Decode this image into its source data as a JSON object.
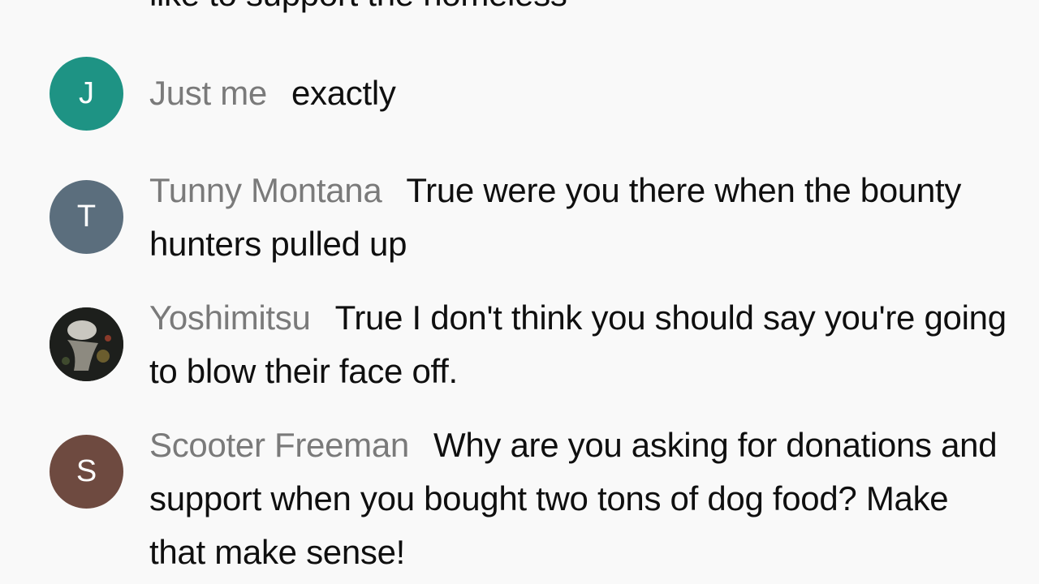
{
  "messages": [
    {
      "author": "",
      "text": "like to support the homeless",
      "avatar_letter": "",
      "avatar_color": "#9aa1a6"
    },
    {
      "author": "Just me",
      "text": "exactly",
      "avatar_letter": "J",
      "avatar_color": "#1e9384"
    },
    {
      "author": "Tunny Montana",
      "text": "True were you there when the bounty hunters pulled up",
      "avatar_letter": "T",
      "avatar_color": "#5b6e7d"
    },
    {
      "author": "Yoshimitsu",
      "text": "True I don't think you should say you're going to blow their face off.",
      "avatar_letter": "",
      "avatar_color": "#1d1f1c"
    },
    {
      "author": "Scooter Freeman",
      "text": "Why are you asking for donations and support when you bought two tons of dog food? Make that make sense!",
      "avatar_letter": "S",
      "avatar_color": "#6e4a40"
    }
  ]
}
